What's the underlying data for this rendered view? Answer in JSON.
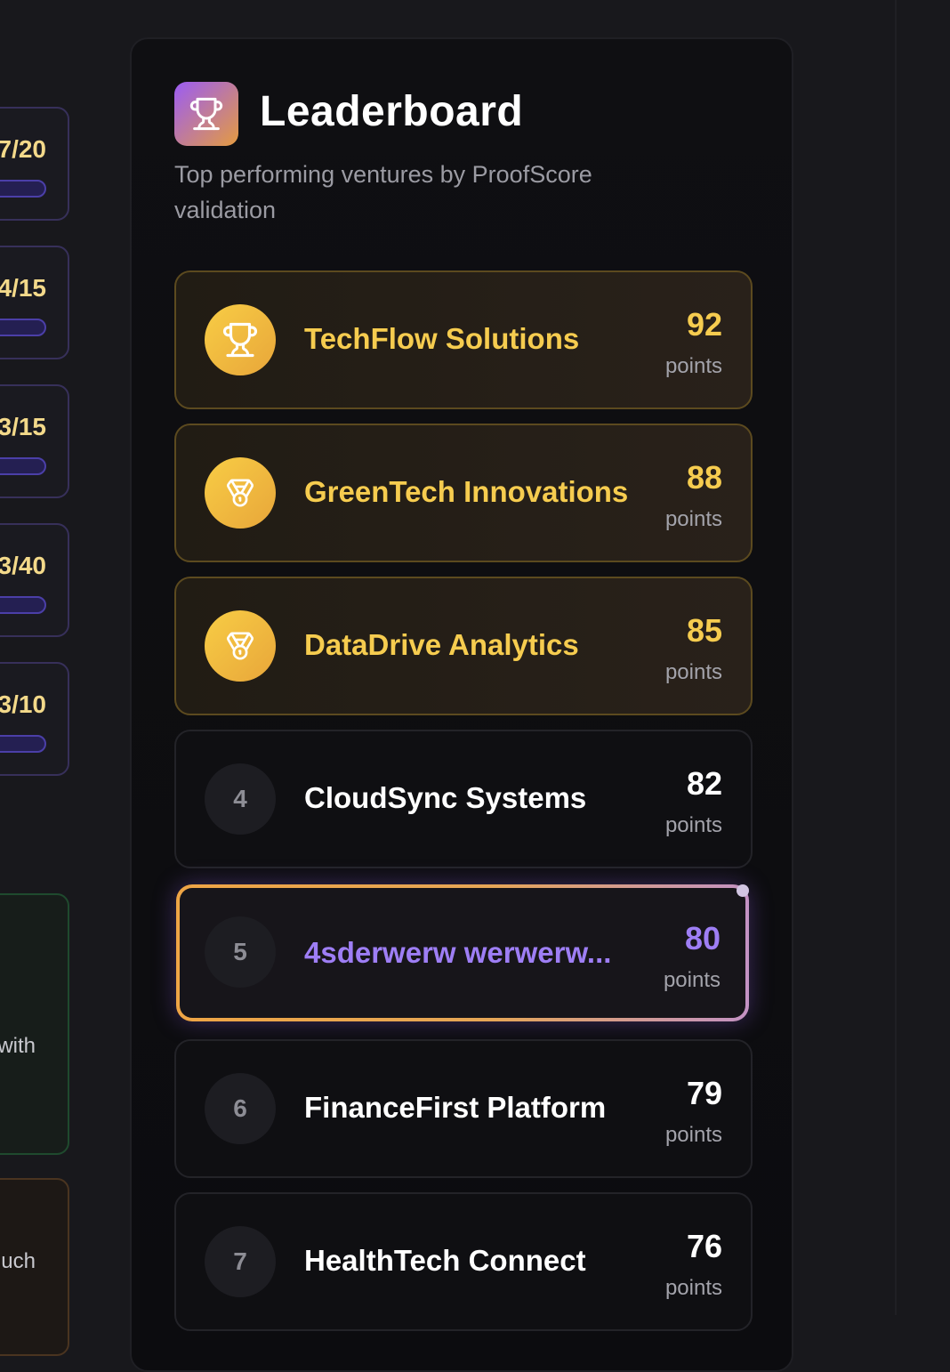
{
  "side_cards": [
    {
      "value": "7/20",
      "progress": 0.15
    },
    {
      "value": "4/15",
      "progress": 0.05
    },
    {
      "value": "3/15",
      "progress": 0.0
    },
    {
      "value": "3/40",
      "progress": 0.0
    },
    {
      "value": "3/10",
      "progress": 0.0
    }
  ],
  "side_green_text": "with",
  "side_brown_text": "uch",
  "leaderboard": {
    "title": "Leaderboard",
    "subtitle": "Top performing ventures by ProofScore validation",
    "header_icon": "trophy-icon",
    "points_label": "points",
    "rows": [
      {
        "rank": "1",
        "name": "TechFlow Solutions",
        "score": "92",
        "style": "gold",
        "icon": "trophy-icon"
      },
      {
        "rank": "2",
        "name": "GreenTech Innovations",
        "score": "88",
        "style": "gold",
        "icon": "medal-icon"
      },
      {
        "rank": "3",
        "name": "DataDrive Analytics",
        "score": "85",
        "style": "gold",
        "icon": "medal-icon"
      },
      {
        "rank": "4",
        "name": "CloudSync Systems",
        "score": "82",
        "style": "plain"
      },
      {
        "rank": "5",
        "name": "4sderwerw werwerw...",
        "score": "80",
        "style": "highlight"
      },
      {
        "rank": "6",
        "name": "FinanceFirst Platform",
        "score": "79",
        "style": "plain"
      },
      {
        "rank": "7",
        "name": "HealthTech Connect",
        "score": "76",
        "style": "plain"
      }
    ]
  },
  "colors": {
    "gold": "#f6cc4f",
    "highlight_text": "#9e7ef5",
    "background": "#18181c"
  }
}
